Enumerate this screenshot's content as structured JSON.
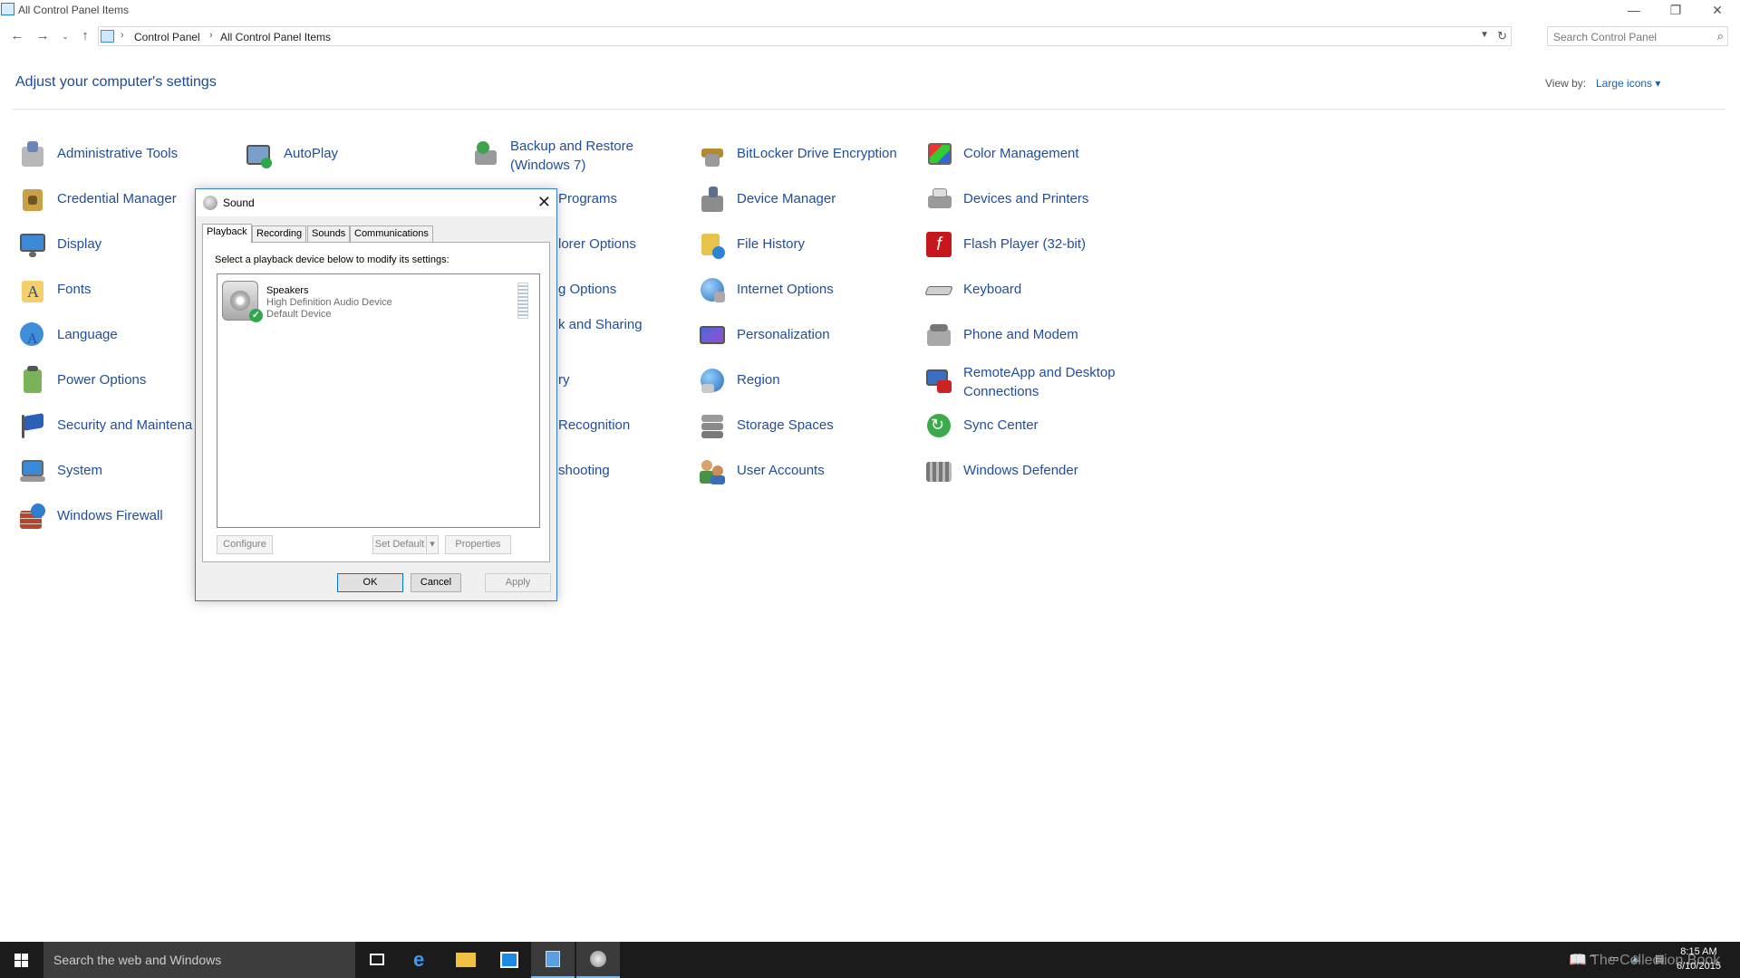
{
  "window": {
    "title": "All Control Panel Items"
  },
  "address": {
    "crumbs": [
      "Control Panel",
      "All Control Panel Items"
    ],
    "search_placeholder": "Search Control Panel"
  },
  "header": {
    "heading": "Adjust your computer's settings",
    "view_by_label": "View by:",
    "view_by_value": "Large icons"
  },
  "items": [
    "Administrative Tools",
    "AutoPlay",
    "Backup and Restore (Windows 7)",
    "BitLocker Drive Encryption",
    "Color Management",
    "Credential Manager",
    "Programs",
    "Device Manager",
    "Devices and Printers",
    "Display",
    "lorer Options",
    "File History",
    "Flash Player (32-bit)",
    "Fonts",
    "g Options",
    "Internet Options",
    "Keyboard",
    "Language",
    "k and Sharing",
    "Personalization",
    "Phone and Modem",
    "Power Options",
    "ry",
    "Region",
    "RemoteApp and Desktop Connections",
    "Security and Maintena",
    "Recognition",
    "Storage Spaces",
    "Sync Center",
    "System",
    "shooting",
    "User Accounts",
    "Windows Defender",
    "Windows Firewall"
  ],
  "dialog": {
    "title": "Sound",
    "tabs": [
      "Playback",
      "Recording",
      "Sounds",
      "Communications"
    ],
    "instruction": "Select a playback device below to modify its settings:",
    "device": {
      "name": "Speakers",
      "description": "High Definition Audio Device",
      "status": "Default Device"
    },
    "buttons": {
      "configure": "Configure",
      "set_default": "Set Default",
      "properties": "Properties",
      "ok": "OK",
      "cancel": "Cancel",
      "apply": "Apply"
    }
  },
  "taskbar": {
    "search_placeholder": "Search the web and Windows",
    "time": "8:15 AM",
    "date": "6/10/2015",
    "watermark": "The Collection Book"
  },
  "colors": {
    "link": "#1f4e9c",
    "taskbar": "#1b1b1b",
    "accent": "#0078d7"
  }
}
